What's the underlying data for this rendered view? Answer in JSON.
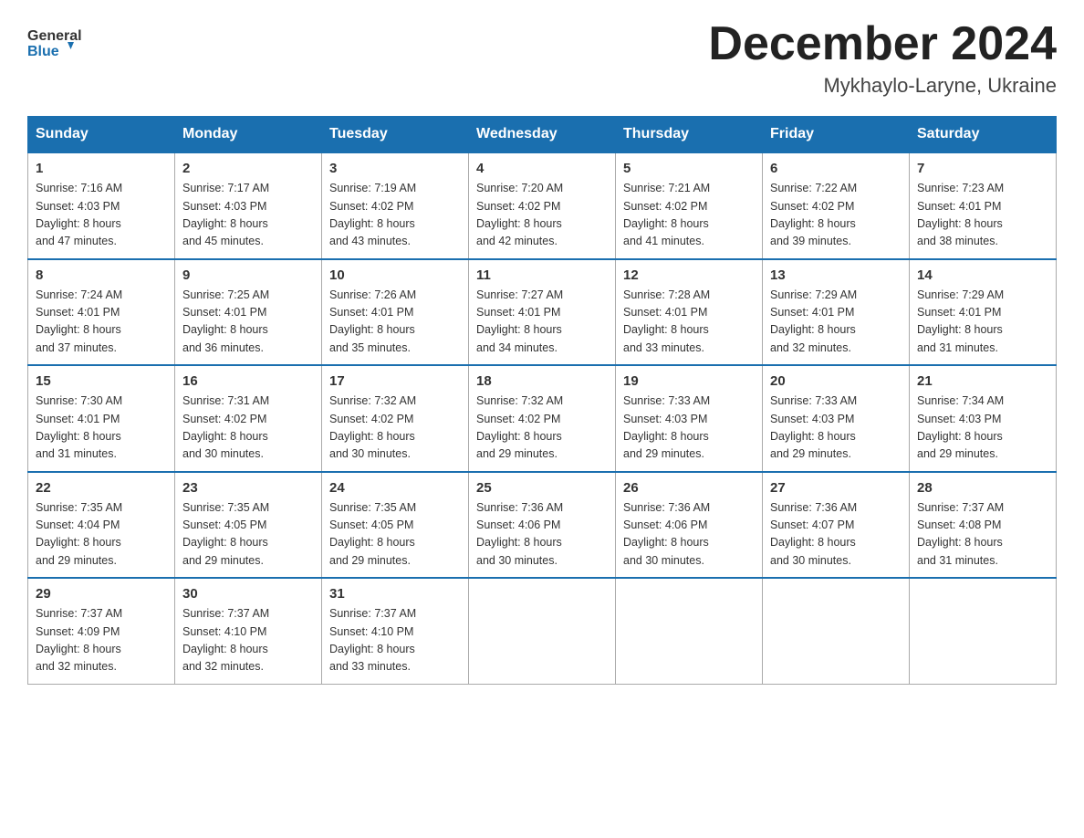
{
  "logo": {
    "general": "General",
    "blue": "Blue"
  },
  "title": "December 2024",
  "subtitle": "Mykhaylo-Laryne, Ukraine",
  "headers": [
    "Sunday",
    "Monday",
    "Tuesday",
    "Wednesday",
    "Thursday",
    "Friday",
    "Saturday"
  ],
  "weeks": [
    [
      {
        "day": "1",
        "sunrise": "7:16 AM",
        "sunset": "4:03 PM",
        "daylight": "8 hours and 47 minutes."
      },
      {
        "day": "2",
        "sunrise": "7:17 AM",
        "sunset": "4:03 PM",
        "daylight": "8 hours and 45 minutes."
      },
      {
        "day": "3",
        "sunrise": "7:19 AM",
        "sunset": "4:02 PM",
        "daylight": "8 hours and 43 minutes."
      },
      {
        "day": "4",
        "sunrise": "7:20 AM",
        "sunset": "4:02 PM",
        "daylight": "8 hours and 42 minutes."
      },
      {
        "day": "5",
        "sunrise": "7:21 AM",
        "sunset": "4:02 PM",
        "daylight": "8 hours and 41 minutes."
      },
      {
        "day": "6",
        "sunrise": "7:22 AM",
        "sunset": "4:02 PM",
        "daylight": "8 hours and 39 minutes."
      },
      {
        "day": "7",
        "sunrise": "7:23 AM",
        "sunset": "4:01 PM",
        "daylight": "8 hours and 38 minutes."
      }
    ],
    [
      {
        "day": "8",
        "sunrise": "7:24 AM",
        "sunset": "4:01 PM",
        "daylight": "8 hours and 37 minutes."
      },
      {
        "day": "9",
        "sunrise": "7:25 AM",
        "sunset": "4:01 PM",
        "daylight": "8 hours and 36 minutes."
      },
      {
        "day": "10",
        "sunrise": "7:26 AM",
        "sunset": "4:01 PM",
        "daylight": "8 hours and 35 minutes."
      },
      {
        "day": "11",
        "sunrise": "7:27 AM",
        "sunset": "4:01 PM",
        "daylight": "8 hours and 34 minutes."
      },
      {
        "day": "12",
        "sunrise": "7:28 AM",
        "sunset": "4:01 PM",
        "daylight": "8 hours and 33 minutes."
      },
      {
        "day": "13",
        "sunrise": "7:29 AM",
        "sunset": "4:01 PM",
        "daylight": "8 hours and 32 minutes."
      },
      {
        "day": "14",
        "sunrise": "7:29 AM",
        "sunset": "4:01 PM",
        "daylight": "8 hours and 31 minutes."
      }
    ],
    [
      {
        "day": "15",
        "sunrise": "7:30 AM",
        "sunset": "4:01 PM",
        "daylight": "8 hours and 31 minutes."
      },
      {
        "day": "16",
        "sunrise": "7:31 AM",
        "sunset": "4:02 PM",
        "daylight": "8 hours and 30 minutes."
      },
      {
        "day": "17",
        "sunrise": "7:32 AM",
        "sunset": "4:02 PM",
        "daylight": "8 hours and 30 minutes."
      },
      {
        "day": "18",
        "sunrise": "7:32 AM",
        "sunset": "4:02 PM",
        "daylight": "8 hours and 29 minutes."
      },
      {
        "day": "19",
        "sunrise": "7:33 AM",
        "sunset": "4:03 PM",
        "daylight": "8 hours and 29 minutes."
      },
      {
        "day": "20",
        "sunrise": "7:33 AM",
        "sunset": "4:03 PM",
        "daylight": "8 hours and 29 minutes."
      },
      {
        "day": "21",
        "sunrise": "7:34 AM",
        "sunset": "4:03 PM",
        "daylight": "8 hours and 29 minutes."
      }
    ],
    [
      {
        "day": "22",
        "sunrise": "7:35 AM",
        "sunset": "4:04 PM",
        "daylight": "8 hours and 29 minutes."
      },
      {
        "day": "23",
        "sunrise": "7:35 AM",
        "sunset": "4:05 PM",
        "daylight": "8 hours and 29 minutes."
      },
      {
        "day": "24",
        "sunrise": "7:35 AM",
        "sunset": "4:05 PM",
        "daylight": "8 hours and 29 minutes."
      },
      {
        "day": "25",
        "sunrise": "7:36 AM",
        "sunset": "4:06 PM",
        "daylight": "8 hours and 30 minutes."
      },
      {
        "day": "26",
        "sunrise": "7:36 AM",
        "sunset": "4:06 PM",
        "daylight": "8 hours and 30 minutes."
      },
      {
        "day": "27",
        "sunrise": "7:36 AM",
        "sunset": "4:07 PM",
        "daylight": "8 hours and 30 minutes."
      },
      {
        "day": "28",
        "sunrise": "7:37 AM",
        "sunset": "4:08 PM",
        "daylight": "8 hours and 31 minutes."
      }
    ],
    [
      {
        "day": "29",
        "sunrise": "7:37 AM",
        "sunset": "4:09 PM",
        "daylight": "8 hours and 32 minutes."
      },
      {
        "day": "30",
        "sunrise": "7:37 AM",
        "sunset": "4:10 PM",
        "daylight": "8 hours and 32 minutes."
      },
      {
        "day": "31",
        "sunrise": "7:37 AM",
        "sunset": "4:10 PM",
        "daylight": "8 hours and 33 minutes."
      },
      null,
      null,
      null,
      null
    ]
  ],
  "labels": {
    "sunrise": "Sunrise:",
    "sunset": "Sunset:",
    "daylight": "Daylight:"
  }
}
